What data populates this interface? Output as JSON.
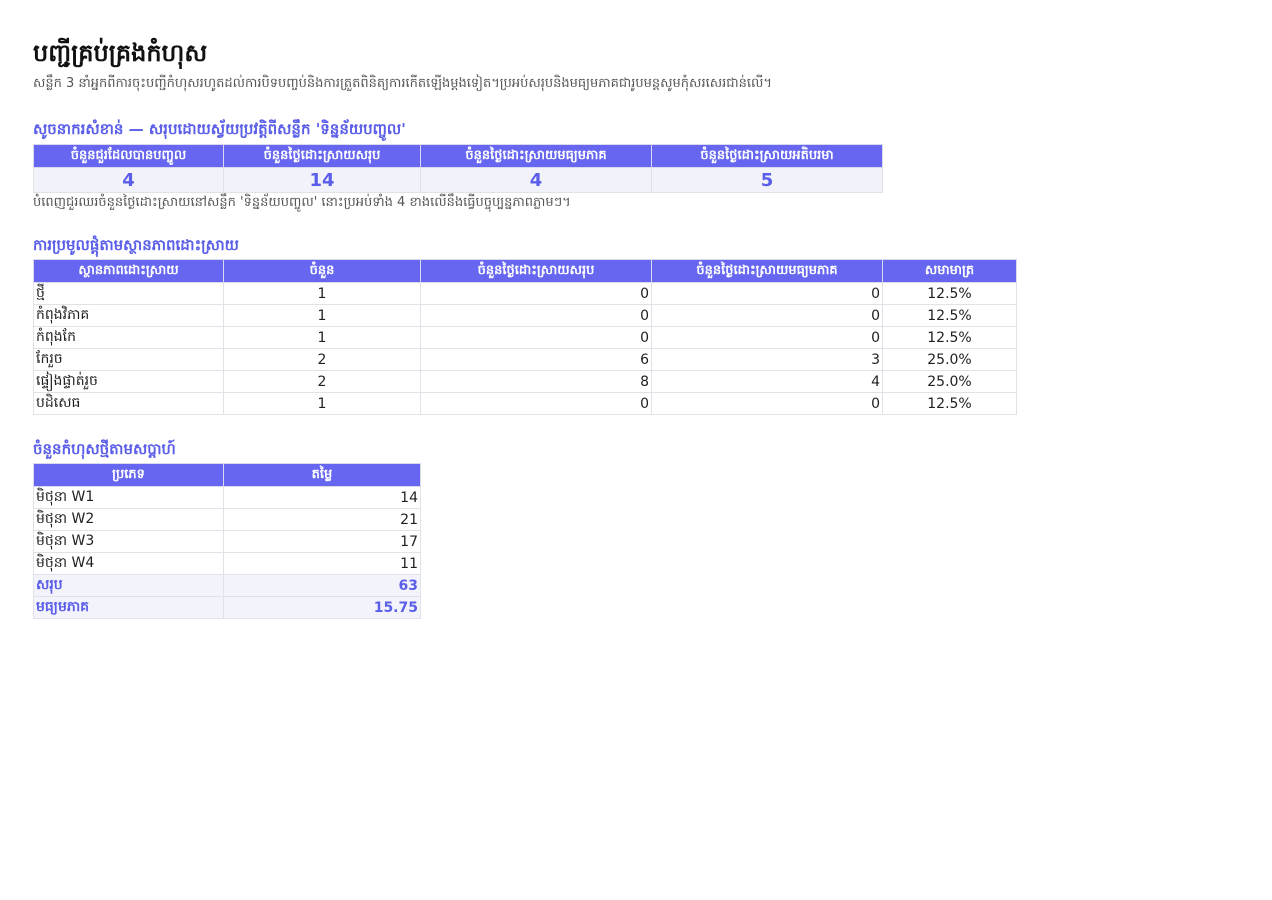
{
  "page": {
    "title": "បញ្ជីគ្រប់គ្រងកំហុស",
    "subtitle": "សន្លឹក 3 នាំអ្នកពីការចុះបញ្ជីកំហុសរហូតដល់ការបិទបញ្ចប់និងការត្រួតពិនិត្យការកើតឡើងម្តងទៀត។ប្រអប់សរុបនិងមធ្យមភាគជារូបមន្តសូមកុំសរសេរជាន់លើ។"
  },
  "kpi": {
    "title": "សូចនាករសំខាន់ — សរុបដោយស្វ័យប្រវត្តិពីសន្លឹក 'ទិន្នន័យបញ្ចូល'",
    "headers": [
      "ចំនួនជួរដែលបានបញ្ចូល",
      "ចំនួនថ្ងៃដោះស្រាយសរុប",
      "ចំនួនថ្ងៃដោះស្រាយមធ្យមភាគ",
      "ចំនួនថ្ងៃដោះស្រាយអតិបរមា"
    ],
    "values": [
      "4",
      "14",
      "4",
      "5"
    ],
    "note": "បំពេញជួរឈរចំនួនថ្ងៃដោះស្រាយនៅសន្លឹក 'ទិន្នន័យបញ្ចូល' នោះប្រអប់ទាំង 4 ខាងលើនឹងធ្វើបច្ចុប្បន្នភាពភ្លាមៗ។"
  },
  "status": {
    "title": "ការប្រមូលផ្តុំតាមស្ថានភាពដោះស្រាយ",
    "headers": [
      "ស្ថានភាពដោះស្រាយ",
      "ចំនួន",
      "ចំនួនថ្ងៃដោះស្រាយសរុប",
      "ចំនួនថ្ងៃដោះស្រាយមធ្យមភាគ",
      "សមាមាត្រ"
    ],
    "rows": [
      [
        "ថ្មី",
        "1",
        "0",
        "0",
        "12.5%"
      ],
      [
        "កំពុងវិភាគ",
        "1",
        "0",
        "0",
        "12.5%"
      ],
      [
        "កំពុងកែ",
        "1",
        "0",
        "0",
        "12.5%"
      ],
      [
        "កែរួច",
        "2",
        "6",
        "3",
        "25.0%"
      ],
      [
        "ផ្ទៀងផ្ទាត់រួច",
        "2",
        "8",
        "4",
        "25.0%"
      ],
      [
        "បដិសេធ",
        "1",
        "0",
        "0",
        "12.5%"
      ]
    ]
  },
  "weekly": {
    "title": "ចំនួនកំហុសថ្មីតាមសប្តាហ៍",
    "headers": [
      "ប្រភេទ",
      "តម្លៃ"
    ],
    "rows": [
      [
        "មិថុនា W1",
        "14"
      ],
      [
        "មិថុនា W2",
        "21"
      ],
      [
        "មិថុនា W3",
        "17"
      ],
      [
        "មិថុនា W4",
        "11"
      ]
    ],
    "summary": [
      [
        "សរុប",
        "63"
      ],
      [
        "មធ្យមភាគ",
        "15.75"
      ]
    ]
  }
}
